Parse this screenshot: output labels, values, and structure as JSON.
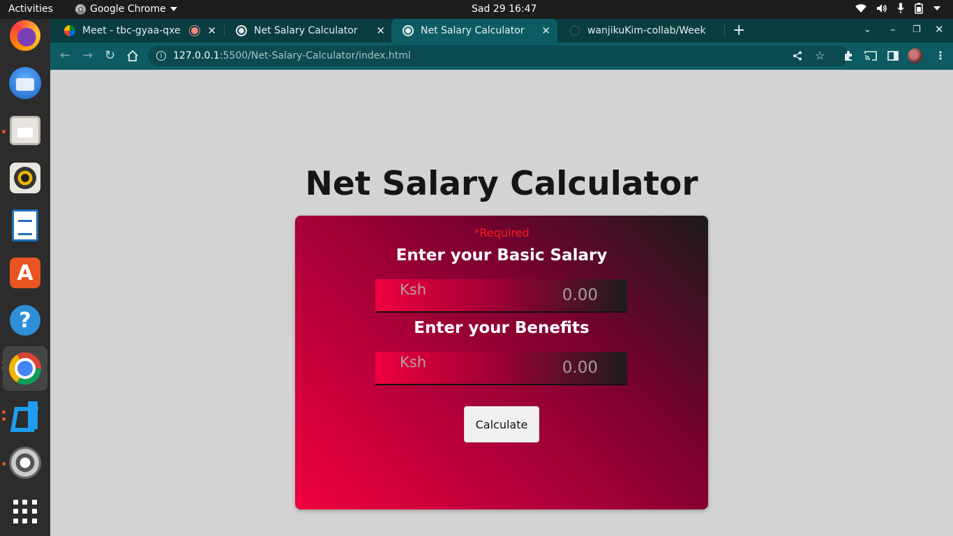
{
  "system": {
    "activities": "Activities",
    "app_menu": "Google Chrome",
    "clock": "Sad 29  16:47"
  },
  "dock": {
    "apps": [
      "firefox-icon",
      "thunderbird-icon",
      "files-icon",
      "rhythmbox-icon",
      "writer-icon",
      "app-store-icon",
      "help-icon",
      "chrome-icon",
      "vscode-icon",
      "settings-icon",
      "show-apps-icon"
    ]
  },
  "browser": {
    "tabs": [
      {
        "label": "Meet - tbc-gyaa-qxe"
      },
      {
        "label": "Net Salary Calculator"
      },
      {
        "label": "Net Salary Calculator"
      },
      {
        "label": "wanjikuKim-collab/Week"
      }
    ],
    "url_host": "127.0.0.1",
    "url_path": ":5500/Net-Salary-Calculator/index.html"
  },
  "page": {
    "title": "Net Salary Calculator",
    "required_note": "*Required",
    "basic_salary": {
      "label": "Enter your Basic Salary",
      "currency": "Ksh",
      "placeholder": "0.00"
    },
    "benefits": {
      "label": "Enter your Benefits",
      "currency": "Ksh",
      "placeholder": "0.00"
    },
    "calculate_label": "Calculate"
  }
}
